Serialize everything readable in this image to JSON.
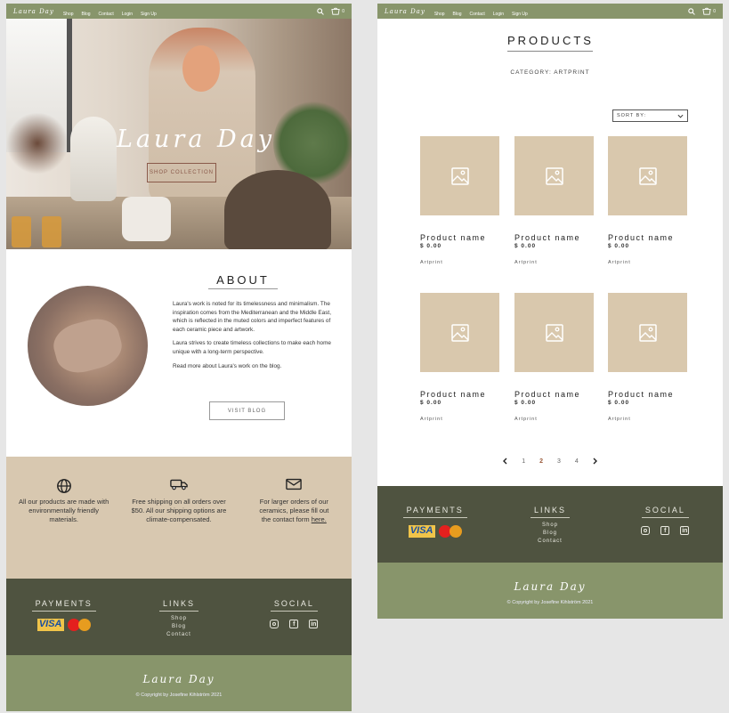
{
  "brand": {
    "logo": "Laura Day"
  },
  "nav": {
    "links": [
      "Shop",
      "Blog",
      "Contact",
      "Login",
      "Sign Up"
    ],
    "cart_count": "0"
  },
  "hero": {
    "title": "Laura Day",
    "button": "SHOP COLLECTION"
  },
  "about": {
    "title": "ABOUT",
    "paragraphs": [
      "Laura's work is noted for its timelessness and minimalism. The inspiration comes from the Mediterranean and the Middle East, which is reflected in the muted colors and imperfect features of each ceramic piece and artwork.",
      "Laura strives to create timeless collections to make each home unique with a long-term perspective.",
      "Read more about Laura's work on the blog."
    ],
    "button": "VISIT BLOG"
  },
  "features": [
    {
      "icon": "globe-icon",
      "text": "All our products are made with environmentally friendly materials."
    },
    {
      "icon": "truck-icon",
      "text": "Free shipping on all orders over $50. All our shipping options are climate-compensated."
    },
    {
      "icon": "mail-icon",
      "text": "For larger orders of our ceramics, please fill out the contact form ",
      "link": "here."
    }
  ],
  "footer": {
    "payments_title": "PAYMENTS",
    "visa": "VISA",
    "links_title": "LINKS",
    "links": [
      "Shop",
      "Blog",
      "Contact"
    ],
    "social_title": "SOCIAL",
    "social_icons": [
      "instagram-icon",
      "facebook-icon",
      "linkedin-icon"
    ],
    "logo": "Laura Day",
    "copyright": "© Copyright by Josefine Kihlström 2021"
  },
  "products_page": {
    "title": "PRODUCTS",
    "category": "CATEGORY: ARTPRINT",
    "sort_label": "SORT BY:",
    "products": [
      {
        "name": "Product name",
        "price": "$ 0.00",
        "category": "Artprint"
      },
      {
        "name": "Product name",
        "price": "$ 0.00",
        "category": "Artprint"
      },
      {
        "name": "Product name",
        "price": "$ 0.00",
        "category": "Artprint"
      },
      {
        "name": "Product name",
        "price": "$ 0.00",
        "category": "Artprint"
      },
      {
        "name": "Product name",
        "price": "$ 0.00",
        "category": "Artprint"
      },
      {
        "name": "Product name",
        "price": "$ 0.00",
        "category": "Artprint"
      }
    ],
    "pages": [
      "1",
      "2",
      "3",
      "4"
    ],
    "current_page": "2"
  },
  "colors": {
    "nav_green": "#88956b",
    "dark_green": "#4f5340",
    "sand": "#d8c8b0",
    "placeholder": "#d9c8ad"
  }
}
